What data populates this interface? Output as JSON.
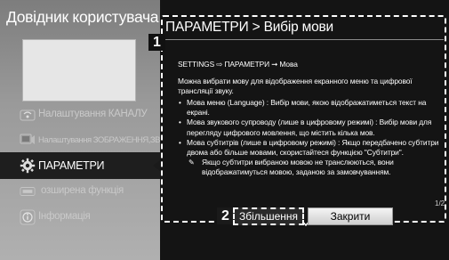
{
  "guide": {
    "title": "Довідник користувача"
  },
  "sidebar": {
    "items": [
      {
        "label": "Налаштування КАНАЛУ",
        "icon": "satellite-dish-icon"
      },
      {
        "label": "Налаштування ЗОБРАЖЕННЯ,ЗВУКУ",
        "icon": "picture-sound-icon"
      },
      {
        "label": "ПАРАМЕТРИ",
        "icon": "gear-icon",
        "selected": true
      },
      {
        "label": "озширена функція",
        "icon": "advanced-function-icon"
      },
      {
        "label": "Інформація",
        "icon": "info-icon"
      }
    ]
  },
  "main": {
    "heading": "ПАРАМЕТРИ > Вибір мови",
    "breadcrumb": "SETTINGS ⇨ ПАРАМЕТРИ ➞ Мова",
    "intro": "Можна вибрати мову для відображення екранного меню та цифрової трансляції звуку.",
    "bullets": [
      "Мова меню (Language) : Вибір мови, якою відображатиметься текст на екрані.",
      "Мова звукового супроводу (лише в цифровому режимі) : Вибір мови для перегляду цифрового мовлення, що містить кілька мов.",
      "Мова субтитрів (лише в цифровому режимі) : Якщо передбачено субтитри двома або більше мовами, скористайтеся функцією \"Субтитри\"."
    ],
    "note_mark": "✎",
    "note": "Якщо субтитри вибраною мовою не транслюються, вони відображатимуться мовою, заданою за замовчуванням.",
    "page_indicator": "1/2"
  },
  "callouts": {
    "one": "1",
    "two": "2"
  },
  "buttons": {
    "zoom_label": "Збільшення",
    "close_label": "Закрити"
  },
  "colors": {
    "panel": "#141414",
    "sidebar_selected": "#1e1e1e",
    "highlight_dash": "#ffffff"
  }
}
